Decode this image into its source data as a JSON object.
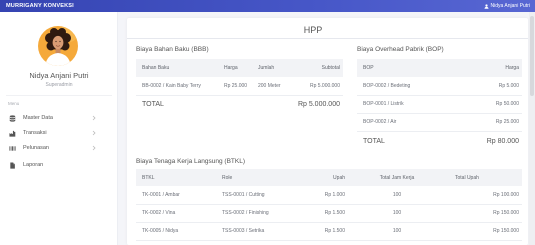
{
  "theme": {
    "topbar": "#4251c6",
    "page_bg": "#f4f5f9",
    "card_bg": "#ffffff",
    "table_header_bg": "#f2f3f6",
    "avatar_bg": "#f5a93a"
  },
  "topbar": {
    "brand": "MURRIGANY KONVEKSI",
    "user_icon": "user-icon",
    "user_name": "Nidya Anjani Putri"
  },
  "sidebar": {
    "profile": {
      "name": "Nidya Anjani Putri",
      "role": "Superadmin"
    },
    "menu_heading": "Menu",
    "items": [
      {
        "label": "Master Data",
        "icon": "database-icon",
        "has_submenu": true
      },
      {
        "label": "Transaksi",
        "icon": "industry-icon",
        "has_submenu": true
      },
      {
        "label": "Pelunasan",
        "icon": "barcode-icon",
        "has_submenu": true
      },
      {
        "label": "Laporan",
        "icon": "file-icon",
        "has_submenu": false
      }
    ]
  },
  "page": {
    "title": "HPP"
  },
  "bbb": {
    "title": "Biaya Bahan Baku (BBB)",
    "headers": {
      "item": "Bahan Baku",
      "harga": "Harga",
      "jumlah": "Jumlah",
      "subtotal": "Subtotal"
    },
    "rows": [
      {
        "item": "BB-0002 / Kain Baby Terry",
        "harga": "Rp 25.000",
        "jumlah": "200 Meter",
        "subtotal": "Rp 5.000.000"
      }
    ],
    "total": {
      "label": "TOTAL",
      "value": "Rp 5.000.000"
    }
  },
  "bop": {
    "title": "Biaya Overhead Pabrik (BOP)",
    "headers": {
      "item": "BOP",
      "harga": "Harga"
    },
    "rows": [
      {
        "item": "BOP-0002 / Bedeting",
        "harga": "Rp 5.000"
      },
      {
        "item": "BOP-0001 / Listrik",
        "harga": "Rp 50.000"
      },
      {
        "item": "BOP-0002 / Air",
        "harga": "Rp 25.000"
      }
    ],
    "total": {
      "label": "TOTAL",
      "value": "Rp 80.000"
    }
  },
  "btkl": {
    "title": "Biaya Tenaga Kerja Langsung (BTKL)",
    "headers": {
      "pekerja": "BTKL",
      "role": "Role",
      "upah": "Upah",
      "jam": "Total Jam Kerja",
      "total": "Total Upah"
    },
    "rows": [
      {
        "pekerja": "TK-0001 / Ambar",
        "role": "TSS-0001 / Cutting",
        "upah": "Rp 1.000",
        "jam": "100",
        "total": "Rp 100.000"
      },
      {
        "pekerja": "TK-0002 / Vina",
        "role": "TSS-0002 / Finishing",
        "upah": "Rp 1.500",
        "jam": "100",
        "total": "Rp 150.000"
      },
      {
        "pekerja": "TK-0005 / Nidya",
        "role": "TSS-0003 / Setrika",
        "upah": "Rp 1.500",
        "jam": "100",
        "total": "Rp 150.000"
      }
    ]
  }
}
